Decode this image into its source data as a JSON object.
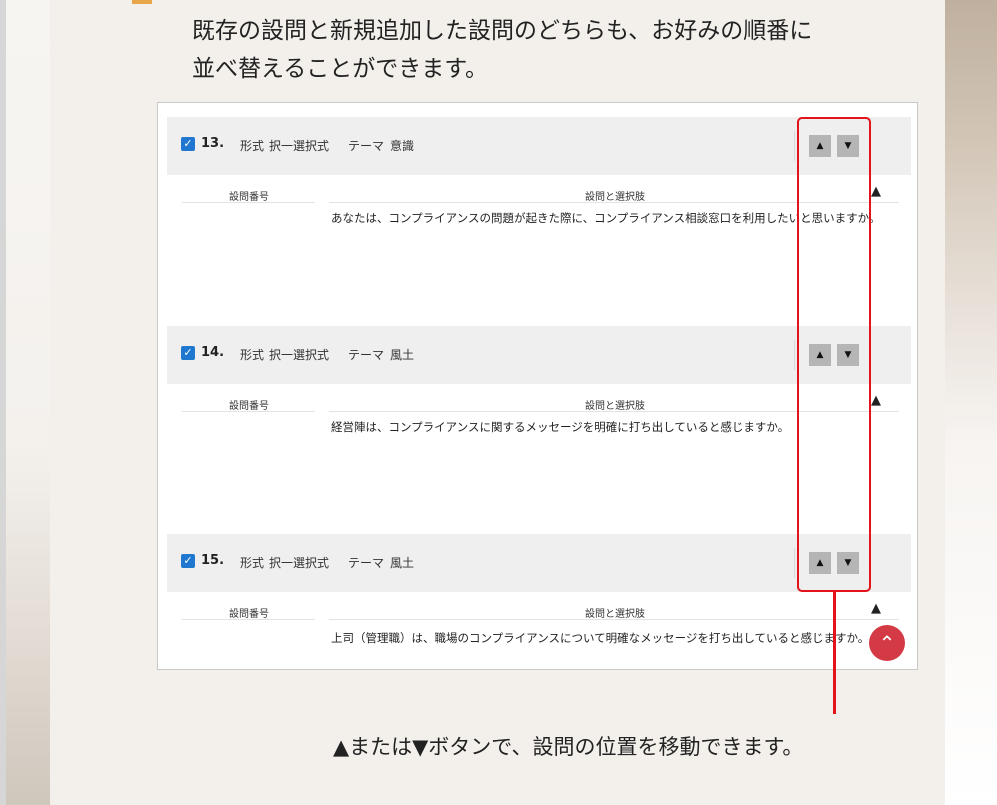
{
  "heading": {
    "line1": "既存の設問と新規追加した設問のどちらも、お好みの順番に",
    "line2": "並べ替えることができます。"
  },
  "questions": [
    {
      "number": "13.",
      "format_label": "形式",
      "format_value": "択一選択式",
      "theme_label": "テーマ",
      "theme_value": "意識",
      "col_number_label": "設問番号",
      "col_choice_label": "設問と選択肢",
      "text": "あなたは、コンプライアンスの問題が起きた際に、コンプライアンス相談窓口を利用したいと思いますか。"
    },
    {
      "number": "14.",
      "format_label": "形式",
      "format_value": "択一選択式",
      "theme_label": "テーマ",
      "theme_value": "風土",
      "col_number_label": "設問番号",
      "col_choice_label": "設問と選択肢",
      "text": "経営陣は、コンプライアンスに関するメッセージを明確に打ち出していると感じますか。"
    },
    {
      "number": "15.",
      "format_label": "形式",
      "format_value": "択一選択式",
      "theme_label": "テーマ",
      "theme_value": "風土",
      "col_number_label": "設問番号",
      "col_choice_label": "設問と選択肢",
      "text": "上司（管理職）は、職場のコンプライアンスについて明確なメッセージを打ち出していると感じますか。"
    }
  ],
  "controls": {
    "up_symbol": "▲",
    "down_symbol": "▼",
    "checkmark": "✓",
    "collapse_symbol": "▲",
    "scroll_top_symbol": "⌃"
  },
  "caption": "▲または▼ボタンで、設問の位置を移動できます。",
  "colors": {
    "highlight": "#e3121b",
    "checkbox": "#1f77d0",
    "scroll_top": "#d43a45",
    "accent": "#e8a64a"
  }
}
